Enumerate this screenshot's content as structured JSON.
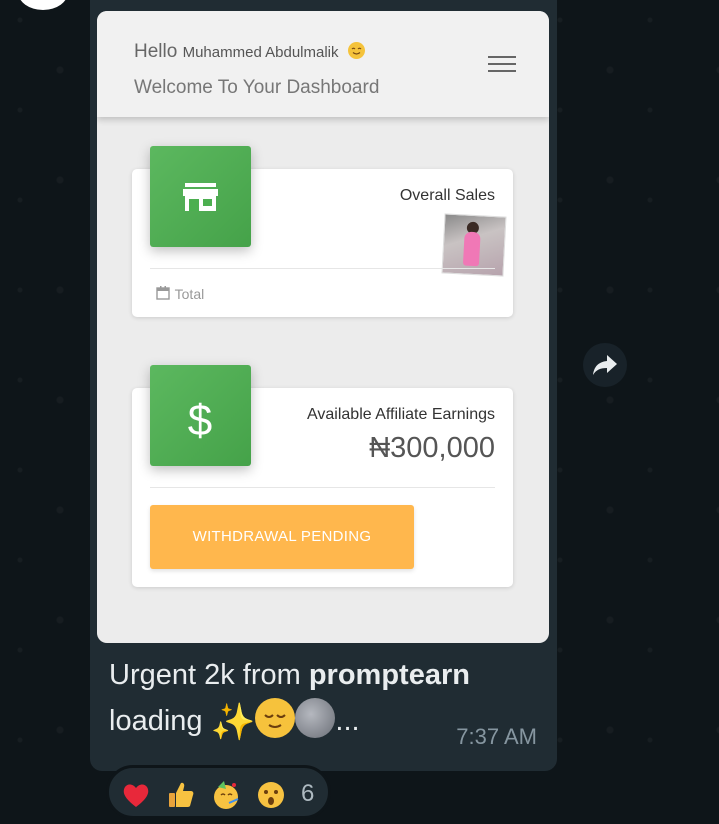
{
  "dashboard": {
    "hello": "Hello",
    "user_name": "Muhammed Abdulmalik",
    "welcome": "Welcome To Your Dashboard",
    "sales_card": {
      "title": "Overall Sales",
      "footer": "Total"
    },
    "earnings_card": {
      "title": "Available Affiliate Earnings",
      "value": "₦300,000",
      "button_label": "WITHDRAWAL PENDING"
    }
  },
  "message": {
    "text_prefix": "Urgent 2k from ",
    "text_bold": "promptearn",
    "text_line2": "loading",
    "ellipsis": "...",
    "time": "7:37 AM"
  },
  "reactions": {
    "emojis": [
      "red-heart",
      "thumbs-up",
      "partying-face",
      "astonished-face"
    ],
    "count": "6"
  },
  "colors": {
    "card_green": "#4caf50",
    "withdraw_orange": "#ffb74d",
    "bubble_bg": "#202c33"
  }
}
